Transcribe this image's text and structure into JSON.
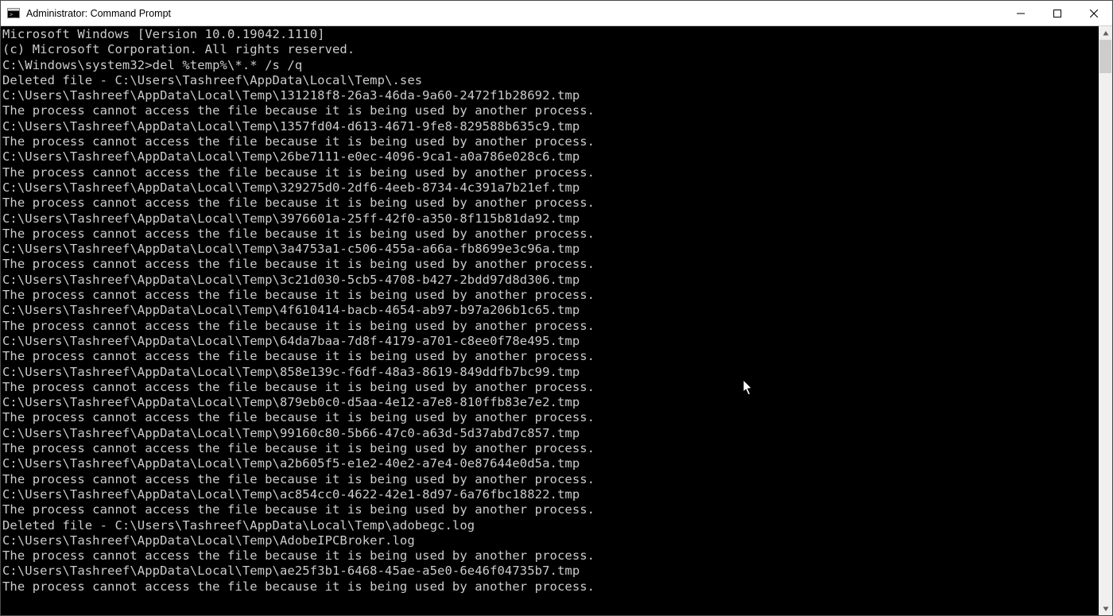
{
  "window": {
    "title": "Administrator: Command Prompt"
  },
  "console": {
    "header": [
      "Microsoft Windows [Version 10.0.19042.1110]",
      "(c) Microsoft Corporation. All rights reserved.",
      ""
    ],
    "prompt_prefix": "C:\\Windows\\system32>",
    "command": "del %temp%\\*.* /s /q",
    "temp_path": "C:\\Users\\Tashreef\\AppData\\Local\\Temp\\",
    "deleted_prefix": "Deleted file - ",
    "access_error": "The process cannot access the file because it is being used by another process.",
    "entries": [
      {
        "type": "deleted",
        "file": ".ses"
      },
      {
        "type": "locked",
        "file": "131218f8-26a3-46da-9a60-2472f1b28692.tmp"
      },
      {
        "type": "locked",
        "file": "1357fd04-d613-4671-9fe8-829588b635c9.tmp"
      },
      {
        "type": "locked",
        "file": "26be7111-e0ec-4096-9ca1-a0a786e028c6.tmp"
      },
      {
        "type": "locked",
        "file": "329275d0-2df6-4eeb-8734-4c391a7b21ef.tmp"
      },
      {
        "type": "locked",
        "file": "3976601a-25ff-42f0-a350-8f115b81da92.tmp"
      },
      {
        "type": "locked",
        "file": "3a4753a1-c506-455a-a66a-fb8699e3c96a.tmp"
      },
      {
        "type": "locked",
        "file": "3c21d030-5cb5-4708-b427-2bdd97d8d306.tmp"
      },
      {
        "type": "locked",
        "file": "4f610414-bacb-4654-ab97-b97a206b1c65.tmp"
      },
      {
        "type": "locked",
        "file": "64da7baa-7d8f-4179-a701-c8ee0f78e495.tmp"
      },
      {
        "type": "locked",
        "file": "858e139c-f6df-48a3-8619-849ddfb7bc99.tmp"
      },
      {
        "type": "locked",
        "file": "879eb0c0-d5aa-4e12-a7e8-810ffb83e7e2.tmp"
      },
      {
        "type": "locked",
        "file": "99160c80-5b66-47c0-a63d-5d37abd7c857.tmp"
      },
      {
        "type": "locked",
        "file": "a2b605f5-e1e2-40e2-a7e4-0e87644e0d5a.tmp"
      },
      {
        "type": "locked",
        "file": "ac854cc0-4622-42e1-8d97-6a76fbc18822.tmp"
      },
      {
        "type": "deleted",
        "file": "adobegc.log"
      },
      {
        "type": "locked",
        "file": "AdobeIPCBroker.log"
      },
      {
        "type": "locked",
        "file": "ae25f3b1-6468-45ae-a5e0-6e46f04735b7.tmp"
      }
    ]
  }
}
